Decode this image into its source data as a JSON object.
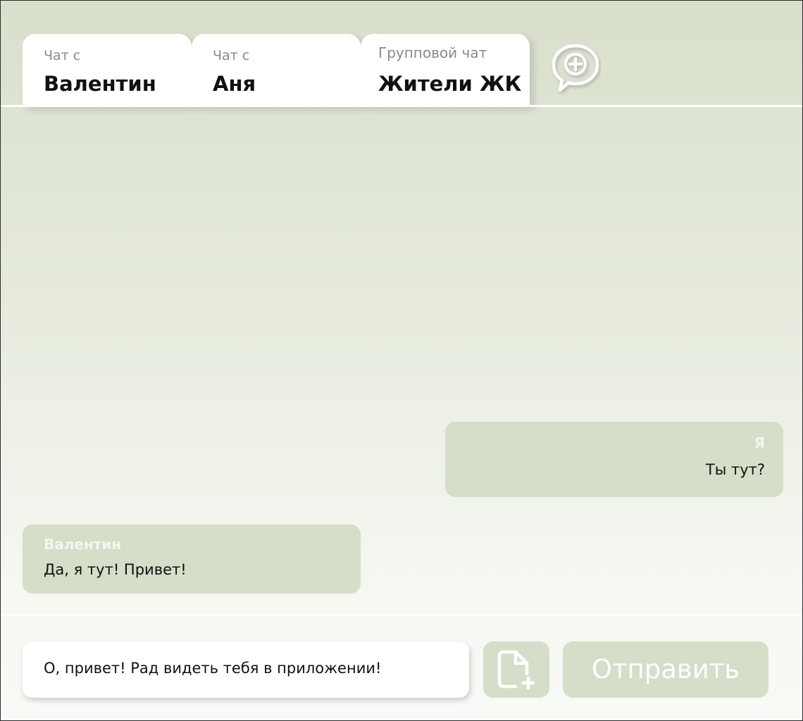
{
  "tabs": [
    {
      "subtitle": "Чат с",
      "name": "Валентин"
    },
    {
      "subtitle": "Чат с",
      "name": "Аня"
    },
    {
      "subtitle": "Групповой чат",
      "name": "Жители ЖК"
    }
  ],
  "new_chat_icon": "chat-bubble-plus-icon",
  "messages": [
    {
      "sender": "Я",
      "text": "Ты тут?",
      "side": "right"
    },
    {
      "sender": "Валентин",
      "text": "Да, я тут! Привет!",
      "side": "left"
    }
  ],
  "composer": {
    "input_value": "О, привет! Рад видеть тебя в приложении!",
    "attach_icon": "file-plus-icon",
    "send_label": "Отправить"
  },
  "colors": {
    "bubble": "#d5dec8",
    "header_bg": "#d8dfcb",
    "send_text": "#ffffff"
  }
}
